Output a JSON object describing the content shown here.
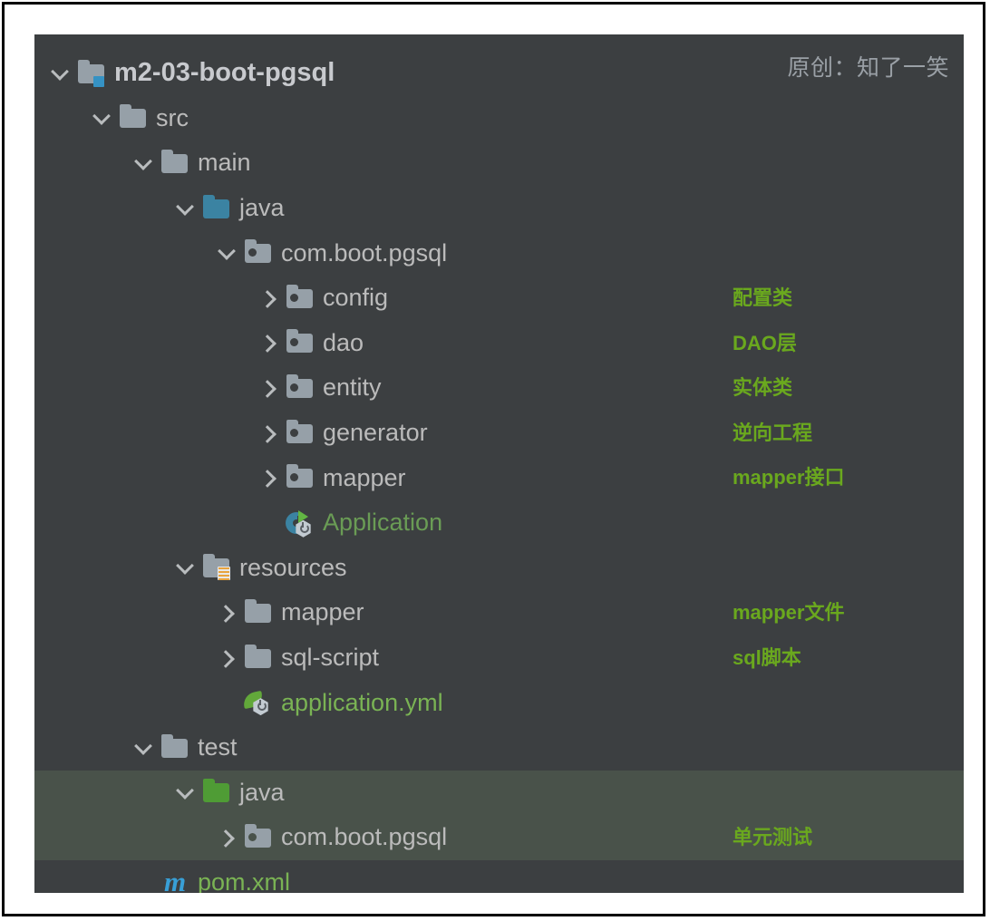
{
  "watermark": "原创：知了一笑",
  "tree": [
    {
      "id": "root",
      "label": "m2-03-boot-pgsql",
      "indent": 0,
      "arrow": "down",
      "icon": "module-folder-icon",
      "style": "root",
      "selected": false,
      "note": ""
    },
    {
      "id": "src",
      "label": "src",
      "indent": 1,
      "arrow": "down",
      "icon": "folder-icon",
      "style": "plain",
      "selected": false,
      "note": ""
    },
    {
      "id": "main",
      "label": "main",
      "indent": 2,
      "arrow": "down",
      "icon": "folder-icon",
      "style": "plain",
      "selected": false,
      "note": ""
    },
    {
      "id": "main-java",
      "label": "java",
      "indent": 3,
      "arrow": "down",
      "icon": "source-folder-icon",
      "style": "plain",
      "selected": false,
      "note": ""
    },
    {
      "id": "basepkg",
      "label": "com.boot.pgsql",
      "indent": 4,
      "arrow": "down",
      "icon": "package-icon",
      "style": "plain",
      "selected": false,
      "note": ""
    },
    {
      "id": "config",
      "label": "config",
      "indent": 5,
      "arrow": "right",
      "icon": "package-icon",
      "style": "plain",
      "selected": false,
      "note": "配置类"
    },
    {
      "id": "dao",
      "label": "dao",
      "indent": 5,
      "arrow": "right",
      "icon": "package-icon",
      "style": "plain",
      "selected": false,
      "note": "DAO层"
    },
    {
      "id": "entity",
      "label": "entity",
      "indent": 5,
      "arrow": "right",
      "icon": "package-icon",
      "style": "plain",
      "selected": false,
      "note": "实体类"
    },
    {
      "id": "generator",
      "label": "generator",
      "indent": 5,
      "arrow": "right",
      "icon": "package-icon",
      "style": "plain",
      "selected": false,
      "note": "逆向工程"
    },
    {
      "id": "mapper-pkg",
      "label": "mapper",
      "indent": 5,
      "arrow": "right",
      "icon": "package-icon",
      "style": "plain",
      "selected": false,
      "note": "mapper接口"
    },
    {
      "id": "application",
      "label": "Application",
      "indent": 5,
      "arrow": "none",
      "icon": "spring-boot-run-icon",
      "style": "green",
      "selected": false,
      "note": ""
    },
    {
      "id": "resources",
      "label": "resources",
      "indent": 3,
      "arrow": "down",
      "icon": "resources-folder-icon",
      "style": "plain",
      "selected": false,
      "note": ""
    },
    {
      "id": "mapper-res",
      "label": "mapper",
      "indent": 4,
      "arrow": "right",
      "icon": "folder-icon",
      "style": "plain",
      "selected": false,
      "note": "mapper文件"
    },
    {
      "id": "sql-script",
      "label": "sql-script",
      "indent": 4,
      "arrow": "right",
      "icon": "folder-icon",
      "style": "plain",
      "selected": false,
      "note": "sql脚本"
    },
    {
      "id": "app-yml",
      "label": "application.yml",
      "indent": 4,
      "arrow": "none",
      "icon": "spring-config-icon",
      "style": "green2",
      "selected": false,
      "note": ""
    },
    {
      "id": "test",
      "label": "test",
      "indent": 2,
      "arrow": "down",
      "icon": "folder-icon",
      "style": "plain",
      "selected": false,
      "note": ""
    },
    {
      "id": "test-java",
      "label": "java",
      "indent": 3,
      "arrow": "down",
      "icon": "test-source-folder-icon",
      "style": "plain",
      "selected": true,
      "note": ""
    },
    {
      "id": "test-pkg",
      "label": "com.boot.pgsql",
      "indent": 4,
      "arrow": "right",
      "icon": "package-icon",
      "style": "plain",
      "selected": true,
      "note": "单元测试"
    },
    {
      "id": "pom",
      "label": "pom.xml",
      "indent": 2,
      "arrow": "none",
      "icon": "maven-icon",
      "style": "green2",
      "selected": false,
      "note": ""
    }
  ],
  "colors": {
    "panel_background": "#3c3f41",
    "selection_background": "#49524a",
    "text": "#bbbbbb",
    "annotation_green": "#6aa81e",
    "source_folder_blue": "#3b83a2",
    "test_folder_green": "#4f9c35",
    "folder_gray": "#96a0a8"
  }
}
